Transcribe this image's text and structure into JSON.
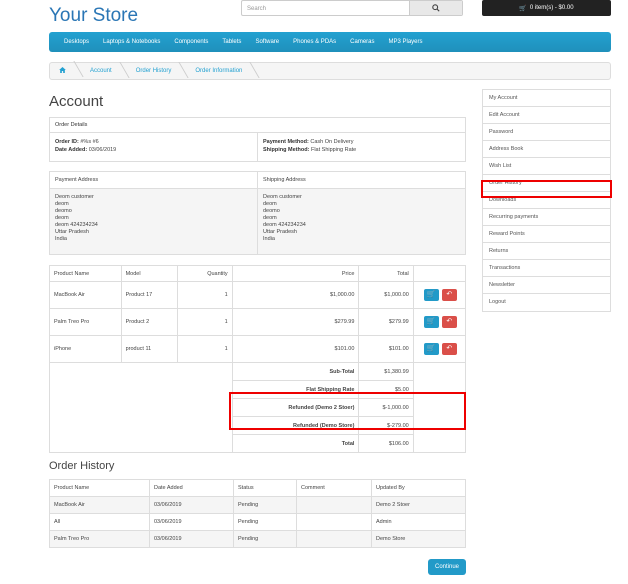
{
  "header": {
    "logo": "Your Store",
    "search_placeholder": "Search",
    "cart_label": "0 item(s) - $0.00"
  },
  "menu": [
    "Desktops",
    "Laptops & Notebooks",
    "Components",
    "Tablets",
    "Software",
    "Phones & PDAs",
    "Cameras",
    "MP3 Players"
  ],
  "breadcrumb": [
    "Account",
    "Order History",
    "Order Information"
  ],
  "page_title": "Account",
  "order_details": {
    "header": "Order Details",
    "order_id_label": "Order ID:",
    "order_id": "#%s #6",
    "date_label": "Date Added:",
    "date": "03/06/2019",
    "payment_method_label": "Payment Method:",
    "payment_method": "Cash On Delivery",
    "shipping_method_label": "Shipping Method:",
    "shipping_method": "Flat Shipping Rate"
  },
  "addresses": {
    "payment_header": "Payment Address",
    "shipping_header": "Shipping Address",
    "payment_lines": [
      "Deom customer",
      "deom",
      "deomo",
      "deom",
      "deom 424234234",
      "Uttar Pradesh",
      "India"
    ],
    "shipping_lines": [
      "Deom customer",
      "deom",
      "deomo",
      "deom",
      "deom 424234234",
      "Uttar Pradesh",
      "India"
    ]
  },
  "products": {
    "headers": [
      "Product Name",
      "Model",
      "Quantity",
      "Price",
      "Total"
    ],
    "rows": [
      {
        "name": "MacBook Air",
        "model": "Product 17",
        "qty": "1",
        "price": "$1,000.00",
        "total": "$1,000.00"
      },
      {
        "name": "Palm Treo Pro",
        "model": "Product 2",
        "qty": "1",
        "price": "$279.99",
        "total": "$279.99"
      },
      {
        "name": "iPhone",
        "model": "product 11",
        "qty": "1",
        "price": "$101.00",
        "total": "$101.00"
      }
    ],
    "totals": [
      {
        "label": "Sub-Total",
        "value": "$1,380.99"
      },
      {
        "label": "Flat Shipping Rate",
        "value": "$5.00"
      },
      {
        "label": "Refunded (Demo 2 Stoer)",
        "value": "$-1,000.00"
      },
      {
        "label": "Refunded (Demo Store)",
        "value": "$-279.00"
      },
      {
        "label": "Total",
        "value": "$106.00"
      }
    ]
  },
  "order_history": {
    "title": "Order History",
    "headers": [
      "Product Name",
      "Date Added",
      "Status",
      "Comment",
      "Updated By"
    ],
    "rows": [
      {
        "name": "MacBook Air",
        "date": "03/06/2019",
        "status": "Pending",
        "comment": "",
        "by": "Demo 2 Stoer"
      },
      {
        "name": "All",
        "date": "03/06/2019",
        "status": "Pending",
        "comment": "",
        "by": "Admin"
      },
      {
        "name": "Palm Treo Pro",
        "date": "03/06/2019",
        "status": "Pending",
        "comment": "",
        "by": "Demo Store"
      }
    ]
  },
  "continue_label": "Continue",
  "sidebar": [
    "My Account",
    "Edit Account",
    "Password",
    "Address Book",
    "Wish List",
    "Order History",
    "Downloads",
    "Recurring payments",
    "Reward Points",
    "Returns",
    "Transactions",
    "Newsletter",
    "Logout"
  ]
}
